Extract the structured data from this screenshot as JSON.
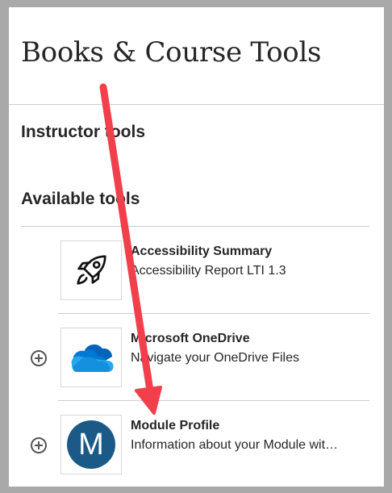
{
  "page": {
    "title": "Books & Course Tools"
  },
  "sections": {
    "instructor_heading": "Instructor tools",
    "available_heading": "Available tools"
  },
  "tools": [
    {
      "name": "Accessibility Summary",
      "description": "Accessibility Report LTI 1.3",
      "icon": "rocket-icon",
      "has_add_button": false
    },
    {
      "name": "Microsoft OneDrive",
      "description": "Navigate your OneDrive Files",
      "icon": "onedrive-cloud-icon",
      "has_add_button": true
    },
    {
      "name": "Module Profile",
      "description": "Information about your Module wit…",
      "icon": "module-profile-logo",
      "icon_letter": "M",
      "has_add_button": true
    }
  ],
  "colors": {
    "annotation_arrow": "#f1404b",
    "onedrive_blue": "#0364b8",
    "module_profile_blue": "#1b5a86"
  }
}
